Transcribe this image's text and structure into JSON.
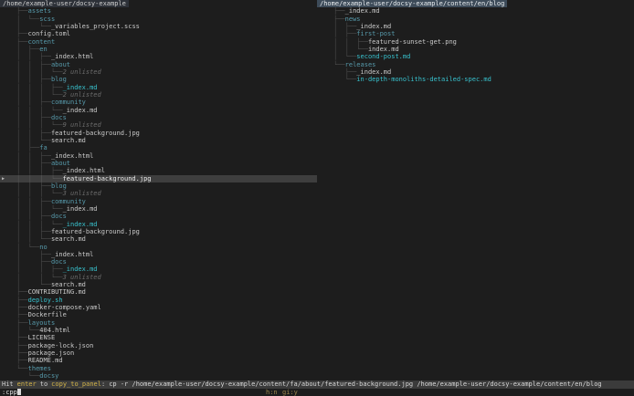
{
  "panels": {
    "left": {
      "root_path": "/home/example-user/docsy-example",
      "rows": [
        {
          "prefix": "├──",
          "name": "assets",
          "type": "dir"
        },
        {
          "prefix": "│  └──",
          "name": "scss",
          "type": "dir"
        },
        {
          "prefix": "│     └──",
          "name": "_variables_project.scss",
          "type": "file"
        },
        {
          "prefix": "├──",
          "name": "config.toml",
          "type": "file"
        },
        {
          "prefix": "├──",
          "name": "content",
          "type": "dir"
        },
        {
          "prefix": "│  ├──",
          "name": "en",
          "type": "dir"
        },
        {
          "prefix": "│  │  ├──",
          "name": "_index.html",
          "type": "file"
        },
        {
          "prefix": "│  │  ├──",
          "name": "about",
          "type": "dir"
        },
        {
          "prefix": "│  │  │  └──",
          "name": "2 unlisted",
          "type": "unlisted"
        },
        {
          "prefix": "│  │  ├──",
          "name": "blog",
          "type": "dir"
        },
        {
          "prefix": "│  │  │  ├──",
          "name": "_index.md",
          "type": "cyan"
        },
        {
          "prefix": "│  │  │  └──",
          "name": "2 unlisted",
          "type": "unlisted"
        },
        {
          "prefix": "│  │  ├──",
          "name": "community",
          "type": "dir"
        },
        {
          "prefix": "│  │  │  └──",
          "name": "_index.md",
          "type": "file"
        },
        {
          "prefix": "│  │  ├──",
          "name": "docs",
          "type": "dir"
        },
        {
          "prefix": "│  │  │  └──",
          "name": "9 unlisted",
          "type": "unlisted"
        },
        {
          "prefix": "│  │  ├──",
          "name": "featured-background.jpg",
          "type": "file"
        },
        {
          "prefix": "│  │  └──",
          "name": "search.md",
          "type": "file"
        },
        {
          "prefix": "│  ├──",
          "name": "fa",
          "type": "dir"
        },
        {
          "prefix": "│  │  ├──",
          "name": "_index.html",
          "type": "file"
        },
        {
          "prefix": "│  │  ├──",
          "name": "about",
          "type": "dir"
        },
        {
          "prefix": "│  │  │  ├──",
          "name": "_index.html",
          "type": "file"
        },
        {
          "prefix": "│  │  │  └──",
          "name": "featured-background.jpg",
          "type": "file",
          "selected": true
        },
        {
          "prefix": "│  │  ├──",
          "name": "blog",
          "type": "dir"
        },
        {
          "prefix": "│  │  │  └──",
          "name": "3 unlisted",
          "type": "unlisted"
        },
        {
          "prefix": "│  │  ├──",
          "name": "community",
          "type": "dir"
        },
        {
          "prefix": "│  │  │  └──",
          "name": "_index.md",
          "type": "file"
        },
        {
          "prefix": "│  │  ├──",
          "name": "docs",
          "type": "dir"
        },
        {
          "prefix": "│  │  │  └──",
          "name": "_index.md",
          "type": "cyan"
        },
        {
          "prefix": "│  │  ├──",
          "name": "featured-background.jpg",
          "type": "file"
        },
        {
          "prefix": "│  │  └──",
          "name": "search.md",
          "type": "file"
        },
        {
          "prefix": "│  └──",
          "name": "no",
          "type": "dir"
        },
        {
          "prefix": "│     ├──",
          "name": "_index.html",
          "type": "file"
        },
        {
          "prefix": "│     ├──",
          "name": "docs",
          "type": "dir"
        },
        {
          "prefix": "│     │  ├──",
          "name": "_index.md",
          "type": "cyan"
        },
        {
          "prefix": "│     │  └──",
          "name": "3 unlisted",
          "type": "unlisted"
        },
        {
          "prefix": "│     └──",
          "name": "search.md",
          "type": "file"
        },
        {
          "prefix": "├──",
          "name": "CONTRIBUTING.md",
          "type": "file"
        },
        {
          "prefix": "├──",
          "name": "deploy.sh",
          "type": "cyan"
        },
        {
          "prefix": "├──",
          "name": "docker-compose.yaml",
          "type": "file"
        },
        {
          "prefix": "├──",
          "name": "Dockerfile",
          "type": "file"
        },
        {
          "prefix": "├──",
          "name": "layouts",
          "type": "dir"
        },
        {
          "prefix": "│  └──",
          "name": "404.html",
          "type": "file"
        },
        {
          "prefix": "├──",
          "name": "LICENSE",
          "type": "file"
        },
        {
          "prefix": "├──",
          "name": "package-lock.json",
          "type": "file"
        },
        {
          "prefix": "├──",
          "name": "package.json",
          "type": "file"
        },
        {
          "prefix": "├──",
          "name": "README.md",
          "type": "file"
        },
        {
          "prefix": "└──",
          "name": "themes",
          "type": "dir"
        },
        {
          "prefix": "   └──",
          "name": "docsy",
          "type": "dir"
        }
      ]
    },
    "right": {
      "root_path": "/home/example-user/docsy-example/content/en/blog",
      "rows": [
        {
          "prefix": "├──",
          "name": "_index.md",
          "type": "file"
        },
        {
          "prefix": "├──",
          "name": "news",
          "type": "dir"
        },
        {
          "prefix": "│  ├──",
          "name": "_index.md",
          "type": "file"
        },
        {
          "prefix": "│  ├──",
          "name": "first-post",
          "type": "dir"
        },
        {
          "prefix": "│  │  ├──",
          "name": "featured-sunset-get.png",
          "type": "file"
        },
        {
          "prefix": "│  │  └──",
          "name": "index.md",
          "type": "file"
        },
        {
          "prefix": "│  └──",
          "name": "second-post.md",
          "type": "cyan"
        },
        {
          "prefix": "└──",
          "name": "releases",
          "type": "dir"
        },
        {
          "prefix": "   ├──",
          "name": "_index.md",
          "type": "file"
        },
        {
          "prefix": "   └──",
          "name": "in-depth-monoliths-detailed-spec.md",
          "type": "cyan"
        }
      ]
    }
  },
  "status_bar": {
    "hint_prefix": "Hit",
    "key": "enter",
    "connector": "to",
    "action": "copy_to_panel",
    "separator": ":",
    "command": "cp -r /home/example-user/docsy-example/content/fa/about/featured-background.jpg /home/example-user/docsy-example/content/en/blog"
  },
  "input": {
    "value": ":cpp",
    "flag_hidden": "h:n",
    "flag_gitignore": "gi:y"
  },
  "colors": {
    "background": "#1d1d1d",
    "directory": "#579aab",
    "git_file": "#38c1cd",
    "unlisted": "#6b6b6b",
    "selection_bg": "#3e3e3e",
    "status_bg": "#3b3b3b",
    "accent_gold": "#d3b44a",
    "right_header_bg": "#3d4b59",
    "left_header_bg": "#2d3138"
  }
}
